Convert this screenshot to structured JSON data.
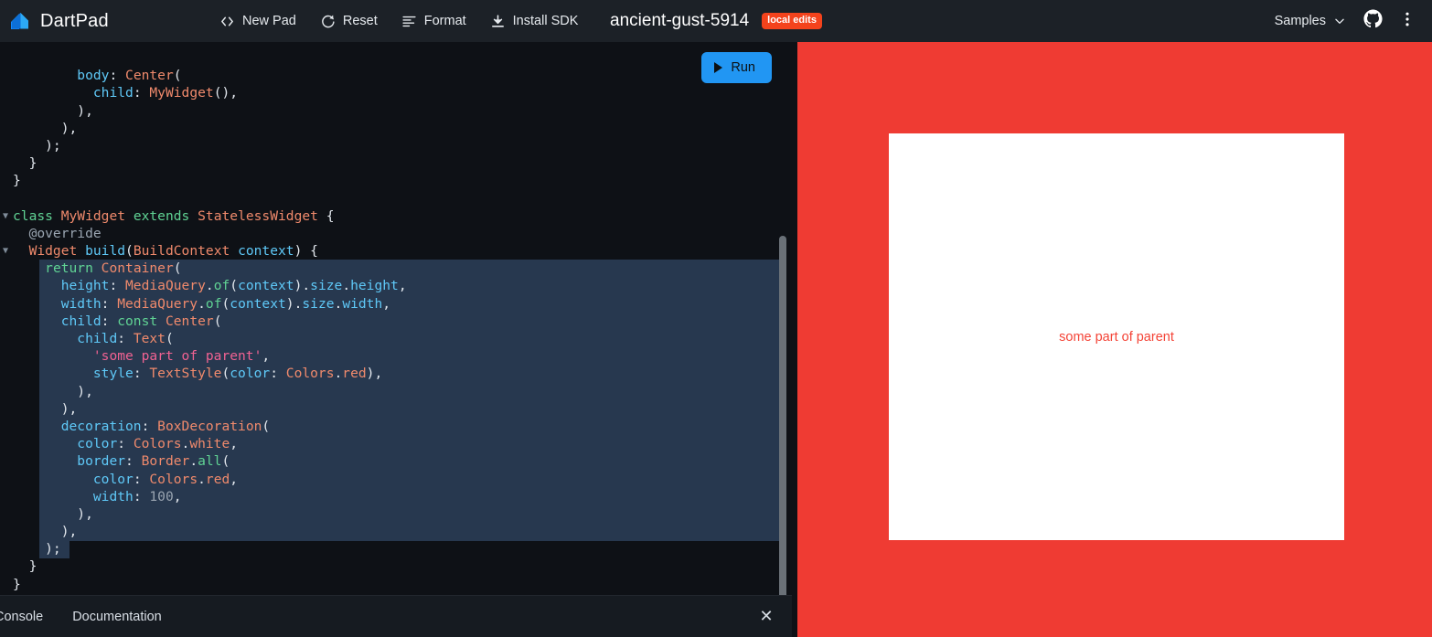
{
  "header": {
    "brand": "DartPad",
    "logo_icon": "dart-logo-icon",
    "toolbar": [
      {
        "label": "New Pad",
        "icon": "code-brackets-icon"
      },
      {
        "label": "Reset",
        "icon": "refresh-icon"
      },
      {
        "label": "Format",
        "icon": "format-align-icon"
      },
      {
        "label": "Install SDK",
        "icon": "download-icon"
      }
    ],
    "doc_title": "ancient-gust-5914",
    "badge": "local edits",
    "samples_label": "Samples",
    "samples_icon": "chevron-down-icon",
    "github_icon": "github-icon",
    "overflow_icon": "more-vert-icon"
  },
  "editor": {
    "run_label": "Run",
    "run_icon": "play-icon",
    "language": "dart",
    "lines": [
      {
        "indent": 0,
        "fold": "",
        "selected": false,
        "tokens": []
      },
      {
        "indent": 0,
        "fold": "",
        "selected": false,
        "tokens": [
          {
            "t": "        ",
            "c": "pun"
          },
          {
            "t": "body",
            "c": "nm"
          },
          {
            "t": ": ",
            "c": "pun"
          },
          {
            "t": "Center",
            "c": "typ"
          },
          {
            "t": "(",
            "c": "pun"
          }
        ]
      },
      {
        "indent": 0,
        "fold": "",
        "selected": false,
        "tokens": [
          {
            "t": "          ",
            "c": "pun"
          },
          {
            "t": "child",
            "c": "nm"
          },
          {
            "t": ": ",
            "c": "pun"
          },
          {
            "t": "MyWidget",
            "c": "typ"
          },
          {
            "t": "(),",
            "c": "pun"
          }
        ]
      },
      {
        "indent": 0,
        "fold": "",
        "selected": false,
        "tokens": [
          {
            "t": "        ),",
            "c": "pun"
          }
        ]
      },
      {
        "indent": 0,
        "fold": "",
        "selected": false,
        "tokens": [
          {
            "t": "      ),",
            "c": "pun"
          }
        ]
      },
      {
        "indent": 0,
        "fold": "",
        "selected": false,
        "tokens": [
          {
            "t": "    );",
            "c": "pun"
          }
        ]
      },
      {
        "indent": 0,
        "fold": "",
        "selected": false,
        "tokens": [
          {
            "t": "  }",
            "c": "pun"
          }
        ]
      },
      {
        "indent": 0,
        "fold": "",
        "selected": false,
        "tokens": [
          {
            "t": "}",
            "c": "pun"
          }
        ]
      },
      {
        "indent": 0,
        "fold": "",
        "selected": false,
        "tokens": []
      },
      {
        "indent": 0,
        "fold": "▼",
        "selected": false,
        "tokens": [
          {
            "t": "class",
            "c": "k"
          },
          {
            "t": " ",
            "c": "pun"
          },
          {
            "t": "MyWidget",
            "c": "typ"
          },
          {
            "t": " ",
            "c": "pun"
          },
          {
            "t": "extends",
            "c": "k"
          },
          {
            "t": " ",
            "c": "pun"
          },
          {
            "t": "StatelessWidget",
            "c": "typ"
          },
          {
            "t": " {",
            "c": "pun"
          }
        ]
      },
      {
        "indent": 0,
        "fold": "",
        "selected": false,
        "tokens": [
          {
            "t": "  @override",
            "c": "ann"
          }
        ]
      },
      {
        "indent": 0,
        "fold": "▼",
        "selected": false,
        "tokens": [
          {
            "t": "  ",
            "c": "pun"
          },
          {
            "t": "Widget",
            "c": "typ"
          },
          {
            "t": " ",
            "c": "pun"
          },
          {
            "t": "build",
            "c": "nm"
          },
          {
            "t": "(",
            "c": "pun"
          },
          {
            "t": "BuildContext",
            "c": "typ"
          },
          {
            "t": " ",
            "c": "pun"
          },
          {
            "t": "context",
            "c": "nm"
          },
          {
            "t": ") {",
            "c": "pun"
          }
        ]
      },
      {
        "indent": 0,
        "fold": "",
        "selected": true,
        "tokens": [
          {
            "t": "    ",
            "c": "pun"
          },
          {
            "t": "return",
            "c": "k"
          },
          {
            "t": " ",
            "c": "pun"
          },
          {
            "t": "Container",
            "c": "typ"
          },
          {
            "t": "(",
            "c": "pun"
          }
        ]
      },
      {
        "indent": 0,
        "fold": "",
        "selected": true,
        "tokens": [
          {
            "t": "      ",
            "c": "pun"
          },
          {
            "t": "height",
            "c": "nm"
          },
          {
            "t": ": ",
            "c": "pun"
          },
          {
            "t": "MediaQuery",
            "c": "typ"
          },
          {
            "t": ".",
            "c": "pun"
          },
          {
            "t": "of",
            "c": "mth"
          },
          {
            "t": "(",
            "c": "pun"
          },
          {
            "t": "context",
            "c": "nm"
          },
          {
            "t": ").",
            "c": "pun"
          },
          {
            "t": "size",
            "c": "nm"
          },
          {
            "t": ".",
            "c": "pun"
          },
          {
            "t": "height",
            "c": "nm"
          },
          {
            "t": ",",
            "c": "pun"
          }
        ]
      },
      {
        "indent": 0,
        "fold": "",
        "selected": true,
        "tokens": [
          {
            "t": "      ",
            "c": "pun"
          },
          {
            "t": "width",
            "c": "nm"
          },
          {
            "t": ": ",
            "c": "pun"
          },
          {
            "t": "MediaQuery",
            "c": "typ"
          },
          {
            "t": ".",
            "c": "pun"
          },
          {
            "t": "of",
            "c": "mth"
          },
          {
            "t": "(",
            "c": "pun"
          },
          {
            "t": "context",
            "c": "nm"
          },
          {
            "t": ").",
            "c": "pun"
          },
          {
            "t": "size",
            "c": "nm"
          },
          {
            "t": ".",
            "c": "pun"
          },
          {
            "t": "width",
            "c": "nm"
          },
          {
            "t": ",",
            "c": "pun"
          }
        ]
      },
      {
        "indent": 0,
        "fold": "",
        "selected": true,
        "tokens": [
          {
            "t": "      ",
            "c": "pun"
          },
          {
            "t": "child",
            "c": "nm"
          },
          {
            "t": ": ",
            "c": "pun"
          },
          {
            "t": "const",
            "c": "k"
          },
          {
            "t": " ",
            "c": "pun"
          },
          {
            "t": "Center",
            "c": "typ"
          },
          {
            "t": "(",
            "c": "pun"
          }
        ]
      },
      {
        "indent": 0,
        "fold": "",
        "selected": true,
        "tokens": [
          {
            "t": "        ",
            "c": "pun"
          },
          {
            "t": "child",
            "c": "nm"
          },
          {
            "t": ": ",
            "c": "pun"
          },
          {
            "t": "Text",
            "c": "typ"
          },
          {
            "t": "(",
            "c": "pun"
          }
        ]
      },
      {
        "indent": 0,
        "fold": "",
        "selected": true,
        "tokens": [
          {
            "t": "          ",
            "c": "pun"
          },
          {
            "t": "'some part of parent'",
            "c": "str"
          },
          {
            "t": ",",
            "c": "pun"
          }
        ]
      },
      {
        "indent": 0,
        "fold": "",
        "selected": true,
        "tokens": [
          {
            "t": "          ",
            "c": "pun"
          },
          {
            "t": "style",
            "c": "nm"
          },
          {
            "t": ": ",
            "c": "pun"
          },
          {
            "t": "TextStyle",
            "c": "typ"
          },
          {
            "t": "(",
            "c": "pun"
          },
          {
            "t": "color",
            "c": "nm"
          },
          {
            "t": ": ",
            "c": "pun"
          },
          {
            "t": "Colors",
            "c": "typ"
          },
          {
            "t": ".",
            "c": "pun"
          },
          {
            "t": "red",
            "c": "typ"
          },
          {
            "t": "),",
            "c": "pun"
          }
        ]
      },
      {
        "indent": 0,
        "fold": "",
        "selected": true,
        "tokens": [
          {
            "t": "        ),",
            "c": "pun"
          }
        ]
      },
      {
        "indent": 0,
        "fold": "",
        "selected": true,
        "tokens": [
          {
            "t": "      ),",
            "c": "pun"
          }
        ]
      },
      {
        "indent": 0,
        "fold": "",
        "selected": true,
        "tokens": [
          {
            "t": "      ",
            "c": "pun"
          },
          {
            "t": "decoration",
            "c": "nm"
          },
          {
            "t": ": ",
            "c": "pun"
          },
          {
            "t": "BoxDecoration",
            "c": "typ"
          },
          {
            "t": "(",
            "c": "pun"
          }
        ]
      },
      {
        "indent": 0,
        "fold": "",
        "selected": true,
        "tokens": [
          {
            "t": "        ",
            "c": "pun"
          },
          {
            "t": "color",
            "c": "nm"
          },
          {
            "t": ": ",
            "c": "pun"
          },
          {
            "t": "Colors",
            "c": "typ"
          },
          {
            "t": ".",
            "c": "pun"
          },
          {
            "t": "white",
            "c": "typ"
          },
          {
            "t": ",",
            "c": "pun"
          }
        ]
      },
      {
        "indent": 0,
        "fold": "",
        "selected": true,
        "tokens": [
          {
            "t": "        ",
            "c": "pun"
          },
          {
            "t": "border",
            "c": "nm"
          },
          {
            "t": ": ",
            "c": "pun"
          },
          {
            "t": "Border",
            "c": "typ"
          },
          {
            "t": ".",
            "c": "pun"
          },
          {
            "t": "all",
            "c": "mth"
          },
          {
            "t": "(",
            "c": "pun"
          }
        ]
      },
      {
        "indent": 0,
        "fold": "",
        "selected": true,
        "tokens": [
          {
            "t": "          ",
            "c": "pun"
          },
          {
            "t": "color",
            "c": "nm"
          },
          {
            "t": ": ",
            "c": "pun"
          },
          {
            "t": "Colors",
            "c": "typ"
          },
          {
            "t": ".",
            "c": "pun"
          },
          {
            "t": "red",
            "c": "typ"
          },
          {
            "t": ",",
            "c": "pun"
          }
        ]
      },
      {
        "indent": 0,
        "fold": "",
        "selected": true,
        "tokens": [
          {
            "t": "          ",
            "c": "pun"
          },
          {
            "t": "width",
            "c": "nm"
          },
          {
            "t": ": ",
            "c": "pun"
          },
          {
            "t": "100",
            "c": "num"
          },
          {
            "t": ",",
            "c": "pun"
          }
        ]
      },
      {
        "indent": 0,
        "fold": "",
        "selected": true,
        "tokens": [
          {
            "t": "        ),",
            "c": "pun"
          }
        ]
      },
      {
        "indent": 0,
        "fold": "",
        "selected": true,
        "tokens": [
          {
            "t": "      ),",
            "c": "pun"
          }
        ]
      },
      {
        "indent": 0,
        "fold": "",
        "selected": "partial",
        "tokens": [
          {
            "t": "    );",
            "c": "pun"
          }
        ]
      },
      {
        "indent": 0,
        "fold": "",
        "selected": false,
        "tokens": [
          {
            "t": "  }",
            "c": "pun"
          }
        ]
      },
      {
        "indent": 0,
        "fold": "",
        "selected": false,
        "tokens": [
          {
            "t": "}",
            "c": "pun"
          }
        ]
      }
    ]
  },
  "bottom_panel": {
    "tabs": [
      {
        "label": "Console"
      },
      {
        "label": "Documentation"
      }
    ],
    "close_icon": "close-icon",
    "close_label": "✕"
  },
  "preview": {
    "background_color": "#EF3B33",
    "box_color": "#FFFFFF",
    "text": "some part of parent",
    "text_color": "#F44336"
  }
}
